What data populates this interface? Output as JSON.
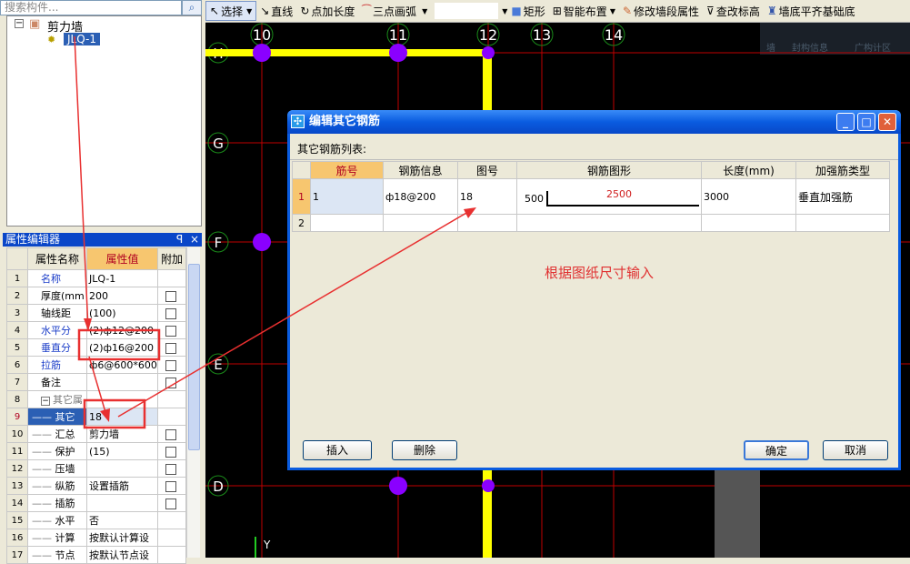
{
  "search": {
    "placeholder": "搜索构件..."
  },
  "tree": {
    "root": "剪力墙",
    "child": "JLQ-1"
  },
  "property_editor": {
    "title": "属性编辑器",
    "columns": [
      "属性名称",
      "属性值",
      "附加"
    ],
    "rows": [
      {
        "n": "1",
        "name": "名称",
        "value": "JLQ-1",
        "check": false,
        "blue": true
      },
      {
        "n": "2",
        "name": "厚度(mm",
        "value": "200",
        "check": true
      },
      {
        "n": "3",
        "name": "轴线距",
        "value": "(100)",
        "check": true
      },
      {
        "n": "4",
        "name": "水平分",
        "value": "(2)ф12@200",
        "check": true,
        "blue": true
      },
      {
        "n": "5",
        "name": "垂直分",
        "value": "(2)ф16@200",
        "check": true,
        "blue": true
      },
      {
        "n": "6",
        "name": "拉筋",
        "value": "ф6@600*600",
        "check": true,
        "blue": true
      },
      {
        "n": "7",
        "name": "备注",
        "value": "",
        "check": true
      },
      {
        "n": "8",
        "name": "其它属",
        "value": "",
        "check": false,
        "group": true
      },
      {
        "n": "9",
        "name": "其它",
        "value": "18",
        "check": false,
        "selected": true
      },
      {
        "n": "10",
        "name": "汇总",
        "value": "剪力墙",
        "check": true
      },
      {
        "n": "11",
        "name": "保护",
        "value": "(15)",
        "check": true
      },
      {
        "n": "12",
        "name": "压墙",
        "value": "",
        "check": true
      },
      {
        "n": "13",
        "name": "纵筋",
        "value": "设置插筋",
        "check": true
      },
      {
        "n": "14",
        "name": "插筋",
        "value": "",
        "check": true
      },
      {
        "n": "15",
        "name": "水平",
        "value": "否",
        "check": false
      },
      {
        "n": "16",
        "name": "计算",
        "value": "按默认计算设",
        "check": false
      },
      {
        "n": "17",
        "name": "节点",
        "value": "按默认节点设",
        "check": false
      }
    ]
  },
  "toolbar": {
    "items": [
      "选择",
      "直线",
      "点加长度",
      "三点画弧",
      "矩形",
      "智能布置",
      "修改墙段属性",
      "查改标高",
      "墙底平齐基础底"
    ]
  },
  "canvas": {
    "col_axes": [
      "10",
      "11",
      "12",
      "13",
      "14"
    ],
    "row_axes": [
      "H",
      "G",
      "F",
      "E",
      "D"
    ],
    "y_label": "Y",
    "background_tabs": [
      "墙",
      "封构信息",
      "广构计区"
    ]
  },
  "dialog": {
    "title": "编辑其它钢筋",
    "list_label": "其它钢筋列表:",
    "columns": [
      "筋号",
      "钢筋信息",
      "图号",
      "钢筋图形",
      "长度(mm)",
      "加强筋类型"
    ],
    "rows": [
      {
        "n": "1",
        "jh": "1",
        "info": "ф18@200",
        "fig": "18",
        "shape_left": "500",
        "shape_top": "2500",
        "length": "3000",
        "type": "垂直加强筋"
      },
      {
        "n": "2",
        "jh": "",
        "info": "",
        "fig": "",
        "shape_left": "",
        "shape_top": "",
        "length": "",
        "type": ""
      }
    ],
    "hint": "根据图纸尺寸输入",
    "buttons": {
      "insert": "插入",
      "delete": "删除",
      "ok": "确定",
      "cancel": "取消"
    }
  },
  "colors": {
    "accent_red": "#e03030",
    "wall_yellow": "#ffff00",
    "axis_red": "#c00000",
    "column_purple": "#8a00ff",
    "title_blue": "#0a5ce0"
  }
}
